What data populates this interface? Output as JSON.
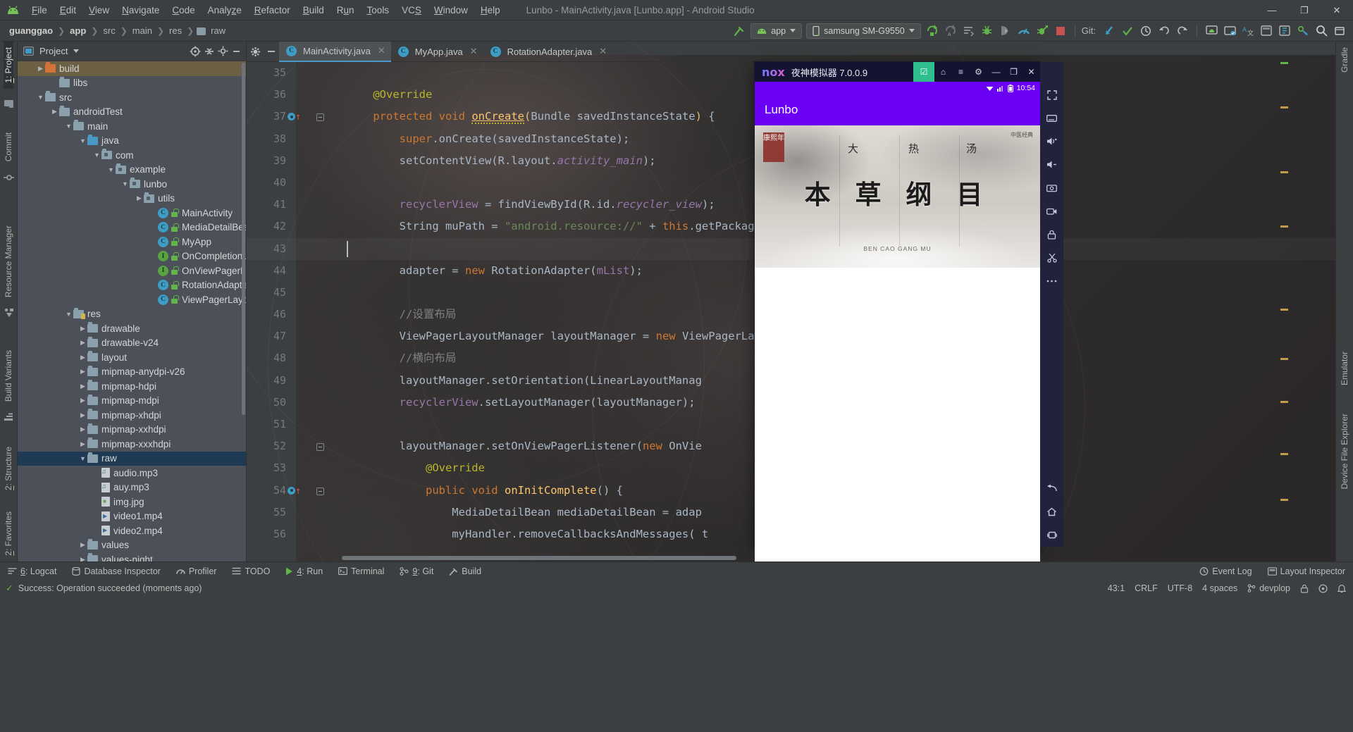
{
  "window": {
    "title": "Lunbo - MainActivity.java [Lunbo.app] - Android Studio",
    "minimize": "—",
    "maximize": "❐",
    "close": "✕"
  },
  "menubar": {
    "logo_icon": "android-logo-icon",
    "items": [
      {
        "label": "File",
        "mnemonic": "F"
      },
      {
        "label": "Edit",
        "mnemonic": "E"
      },
      {
        "label": "View",
        "mnemonic": "V"
      },
      {
        "label": "Navigate",
        "mnemonic": "N"
      },
      {
        "label": "Code",
        "mnemonic": "C"
      },
      {
        "label": "Analyze",
        "mnemonic": "z"
      },
      {
        "label": "Refactor",
        "mnemonic": "R"
      },
      {
        "label": "Build",
        "mnemonic": "B"
      },
      {
        "label": "Run",
        "mnemonic": "u"
      },
      {
        "label": "Tools",
        "mnemonic": "T"
      },
      {
        "label": "VCS",
        "mnemonic": "S"
      },
      {
        "label": "Window",
        "mnemonic": "W"
      },
      {
        "label": "Help",
        "mnemonic": "H"
      }
    ]
  },
  "breadcrumbs": [
    {
      "label": "guanggao",
      "bold": true
    },
    {
      "label": "app",
      "bold": true
    },
    {
      "label": "src",
      "bold": false
    },
    {
      "label": "main",
      "bold": false
    },
    {
      "label": "res",
      "bold": false
    },
    {
      "label": "raw",
      "bold": false,
      "folder": true
    }
  ],
  "toolbar": {
    "hammer_icon": "build-hammer-icon",
    "run_config": {
      "label": "app",
      "icon": "android-app-icon"
    },
    "device": {
      "label": "samsung SM-G9550",
      "icon": "phone-icon"
    },
    "run_icon": "run-icon",
    "rerun_icon": "apply-changes-icon",
    "apply_code_icon": "apply-code-changes-icon",
    "debug_icon": "debug-icon",
    "attach_debug_icon": "attach-debugger-icon",
    "profiler_icon": "profiler-icon",
    "run_with_coverage_icon": "run-coverage-icon",
    "stop_icon": "stop-icon",
    "git_label": "Git:",
    "git_update_icon": "git-update-icon",
    "git_commit_icon": "git-commit-check-icon",
    "git_history_icon": "git-history-icon",
    "undo_icon": "undo-icon",
    "redo_icon": "redo-icon",
    "avd_icon": "avd-manager-icon",
    "sdk_icon": "sdk-manager-icon",
    "translate_icon": "translate-icon",
    "layout_icon": "layout-editor-icon",
    "project_structure_icon": "project-structure-icon",
    "sync_icon": "gradle-sync-icon",
    "search_icon": "search-icon",
    "more_icon": "more-icon"
  },
  "left_strip": {
    "tabs": [
      {
        "label": "1: Project",
        "mnemonic": "1",
        "active": true,
        "icon": "project-icon"
      },
      {
        "label": "Commit",
        "icon": "commit-icon"
      },
      {
        "label": "Resource Manager",
        "icon": "resource-manager-icon"
      },
      {
        "label": "Build Variants",
        "icon": "build-variants-icon"
      },
      {
        "label": "2: Structure",
        "mnemonic": "2",
        "icon": "structure-icon"
      },
      {
        "label": "2: Favorites",
        "mnemonic": "2",
        "icon": "favorites-icon"
      }
    ]
  },
  "right_strip": {
    "tabs": [
      {
        "label": "Gradle",
        "icon": "gradle-icon"
      },
      {
        "label": "Emulator",
        "icon": "emulator-icon"
      },
      {
        "label": "Device File Explorer",
        "icon": "device-file-explorer-icon"
      }
    ],
    "icons": [
      "expand-icon",
      "layout-inspector-icon",
      "volume-up-icon",
      "volume-down-icon",
      "screenshot-icon",
      "screen-record-icon",
      "rotate-icon",
      "scissors-icon",
      "more-dots-icon",
      "back-icon",
      "home-icon",
      "recents-icon"
    ]
  },
  "project_panel": {
    "title": "Project",
    "view_icon": "project-view-icon",
    "caret_icon": "chevron-down-icon",
    "target_icon": "scroll-from-source-icon",
    "collapse_icon": "collapse-all-icon",
    "settings_icon": "gear-icon",
    "hide_icon": "hide-icon",
    "tree": [
      {
        "label": "build",
        "indent": 2,
        "arrow": "right",
        "icon": "folder-orange",
        "selected": "gold"
      },
      {
        "label": "libs",
        "indent": 3,
        "arrow": "none",
        "icon": "folder"
      },
      {
        "label": "src",
        "indent": 2,
        "arrow": "down",
        "icon": "folder"
      },
      {
        "label": "androidTest",
        "indent": 3,
        "arrow": "right",
        "icon": "folder"
      },
      {
        "label": "main",
        "indent": 4,
        "arrow": "down",
        "icon": "folder"
      },
      {
        "label": "java",
        "indent": 5,
        "arrow": "down",
        "icon": "folder-blue"
      },
      {
        "label": "com",
        "indent": 6,
        "arrow": "down",
        "icon": "folder-package"
      },
      {
        "label": "example",
        "indent": 7,
        "arrow": "down",
        "icon": "folder-package"
      },
      {
        "label": "lunbo",
        "indent": 8,
        "arrow": "down",
        "icon": "folder-package"
      },
      {
        "label": "utils",
        "indent": 9,
        "arrow": "right",
        "icon": "folder-package"
      },
      {
        "label": "MainActivity",
        "indent": 10,
        "arrow": "none",
        "icon": "class-badge"
      },
      {
        "label": "MediaDetailBean",
        "indent": 10,
        "arrow": "none",
        "icon": "class-badge"
      },
      {
        "label": "MyApp",
        "indent": 10,
        "arrow": "none",
        "icon": "class-badge"
      },
      {
        "label": "OnCompletionListener",
        "indent": 10,
        "arrow": "none",
        "icon": "interface-badge"
      },
      {
        "label": "OnViewPagerListener",
        "indent": 10,
        "arrow": "none",
        "icon": "interface-badge"
      },
      {
        "label": "RotationAdapter",
        "indent": 10,
        "arrow": "none",
        "icon": "class-badge"
      },
      {
        "label": "ViewPagerLayoutManager",
        "indent": 10,
        "arrow": "none",
        "icon": "class-badge"
      },
      {
        "label": "res",
        "indent": 4,
        "arrow": "down",
        "icon": "folder-res"
      },
      {
        "label": "drawable",
        "indent": 5,
        "arrow": "right",
        "icon": "folder"
      },
      {
        "label": "drawable-v24",
        "indent": 5,
        "arrow": "right",
        "icon": "folder"
      },
      {
        "label": "layout",
        "indent": 5,
        "arrow": "right",
        "icon": "folder"
      },
      {
        "label": "mipmap-anydpi-v26",
        "indent": 5,
        "arrow": "right",
        "icon": "folder"
      },
      {
        "label": "mipmap-hdpi",
        "indent": 5,
        "arrow": "right",
        "icon": "folder"
      },
      {
        "label": "mipmap-mdpi",
        "indent": 5,
        "arrow": "right",
        "icon": "folder"
      },
      {
        "label": "mipmap-xhdpi",
        "indent": 5,
        "arrow": "right",
        "icon": "folder"
      },
      {
        "label": "mipmap-xxhdpi",
        "indent": 5,
        "arrow": "right",
        "icon": "folder"
      },
      {
        "label": "mipmap-xxxhdpi",
        "indent": 5,
        "arrow": "right",
        "icon": "folder"
      },
      {
        "label": "raw",
        "indent": 5,
        "arrow": "down",
        "icon": "folder",
        "selected": "blue"
      },
      {
        "label": "audio.mp3",
        "indent": 6,
        "arrow": "none",
        "icon": "file-audio"
      },
      {
        "label": "auy.mp3",
        "indent": 6,
        "arrow": "none",
        "icon": "file-audio"
      },
      {
        "label": "img.jpg",
        "indent": 6,
        "arrow": "none",
        "icon": "file-image"
      },
      {
        "label": "video1.mp4",
        "indent": 6,
        "arrow": "none",
        "icon": "file-video"
      },
      {
        "label": "video2.mp4",
        "indent": 6,
        "arrow": "none",
        "icon": "file-video"
      },
      {
        "label": "values",
        "indent": 5,
        "arrow": "right",
        "icon": "folder"
      },
      {
        "label": "values-night",
        "indent": 5,
        "arrow": "right",
        "icon": "folder"
      }
    ]
  },
  "editor": {
    "gear_icon": "gear-icon",
    "minimize_icon": "minimize-icon",
    "tabs": [
      {
        "label": "MainActivity.java",
        "active": true,
        "icon": "class-badge",
        "close": "✕"
      },
      {
        "label": "MyApp.java",
        "active": false,
        "icon": "class-badge",
        "close": "✕"
      },
      {
        "label": "RotationAdapter.java",
        "active": false,
        "icon": "class-badge",
        "close": "✕"
      }
    ],
    "lines": [
      {
        "n": "35",
        "tokens": []
      },
      {
        "n": "36",
        "tokens": [
          {
            "t": "    ",
            "c": "txt"
          },
          {
            "t": "@Override",
            "c": "ann"
          }
        ]
      },
      {
        "n": "37",
        "gutter": "run-dot-up-arrow",
        "fold": true,
        "tokens": [
          {
            "t": "    ",
            "c": "txt"
          },
          {
            "t": "protected ",
            "c": "kw"
          },
          {
            "t": "void ",
            "c": "kw"
          },
          {
            "t": "onCreate",
            "c": "fn-u"
          },
          {
            "t": "(",
            "c": "paren"
          },
          {
            "t": "Bundle savedInstanceState",
            "c": "txt"
          },
          {
            "t": ")",
            "c": "paren"
          },
          {
            "t": " {",
            "c": "txt"
          }
        ]
      },
      {
        "n": "38",
        "tokens": [
          {
            "t": "        ",
            "c": "txt"
          },
          {
            "t": "super",
            "c": "kw"
          },
          {
            "t": ".onCreate(savedInstanceState);",
            "c": "txt"
          }
        ]
      },
      {
        "n": "39",
        "tokens": [
          {
            "t": "        setContentView(R.layout.",
            "c": "txt"
          },
          {
            "t": "activity_main",
            "c": "fld-i"
          },
          {
            "t": ");",
            "c": "txt"
          }
        ]
      },
      {
        "n": "40",
        "tokens": []
      },
      {
        "n": "41",
        "tokens": [
          {
            "t": "        ",
            "c": "txt"
          },
          {
            "t": "recyclerView",
            "c": "fld"
          },
          {
            "t": " = findViewById(R.id.",
            "c": "txt"
          },
          {
            "t": "recycler_view",
            "c": "fld-i"
          },
          {
            "t": ");",
            "c": "txt"
          }
        ]
      },
      {
        "n": "42",
        "tokens": [
          {
            "t": "        String muPath = ",
            "c": "txt"
          },
          {
            "t": "\"android.resource://\"",
            "c": "str"
          },
          {
            "t": " + ",
            "c": "txt"
          },
          {
            "t": "this",
            "c": "kw"
          },
          {
            "t": ".getPackageName();",
            "c": "txt"
          }
        ]
      },
      {
        "n": "43",
        "current": true,
        "tokens": []
      },
      {
        "n": "44",
        "tokens": [
          {
            "t": "        adapter = ",
            "c": "txt"
          },
          {
            "t": "new ",
            "c": "kw"
          },
          {
            "t": "RotationAdapter(",
            "c": "txt"
          },
          {
            "t": "mList",
            "c": "fld"
          },
          {
            "t": ");",
            "c": "txt"
          }
        ]
      },
      {
        "n": "45",
        "tokens": []
      },
      {
        "n": "46",
        "tokens": [
          {
            "t": "        //设置布局",
            "c": "cmt"
          }
        ]
      },
      {
        "n": "47",
        "tokens": [
          {
            "t": "        ViewPagerLayoutManager layoutManager = ",
            "c": "txt"
          },
          {
            "t": "new ",
            "c": "kw"
          },
          {
            "t": "ViewPagerLayoutManager(",
            "c": "txt"
          }
        ]
      },
      {
        "n": "48",
        "tokens": [
          {
            "t": "        //横向布局",
            "c": "cmt"
          }
        ]
      },
      {
        "n": "49",
        "tokens": [
          {
            "t": "        layoutManager.setOrientation(LinearLayoutManag",
            "c": "txt"
          }
        ]
      },
      {
        "n": "50",
        "tokens": [
          {
            "t": "        ",
            "c": "txt"
          },
          {
            "t": "recyclerView",
            "c": "fld"
          },
          {
            "t": ".setLayoutManager(layoutManager);",
            "c": "txt"
          }
        ]
      },
      {
        "n": "51",
        "tokens": []
      },
      {
        "n": "52",
        "fold": true,
        "tokens": [
          {
            "t": "        layoutManager.setOnViewPagerListener(",
            "c": "txt"
          },
          {
            "t": "new ",
            "c": "kw"
          },
          {
            "t": "OnVie",
            "c": "txt"
          }
        ]
      },
      {
        "n": "53",
        "tokens": [
          {
            "t": "            ",
            "c": "txt"
          },
          {
            "t": "@Override",
            "c": "ann"
          }
        ]
      },
      {
        "n": "54",
        "gutter": "run-dot-up-arrow",
        "fold": true,
        "tokens": [
          {
            "t": "            ",
            "c": "txt"
          },
          {
            "t": "public ",
            "c": "kw"
          },
          {
            "t": "void ",
            "c": "kw"
          },
          {
            "t": "onInitComplete",
            "c": "fn"
          },
          {
            "t": "() {",
            "c": "txt"
          }
        ]
      },
      {
        "n": "55",
        "tokens": [
          {
            "t": "                MediaDetailBean mediaDetailBean = adap",
            "c": "txt"
          }
        ]
      },
      {
        "n": "56",
        "tokens": [
          {
            "t": "                myHandler.removeCallbacksAndMessages( t",
            "c": "txt"
          }
        ]
      }
    ]
  },
  "nox": {
    "logo": "nox",
    "name": "夜神模拟器 7.0.0.9",
    "controls": [
      {
        "icon": "nox-store-icon",
        "green": true,
        "label": "☑"
      },
      {
        "icon": "nox-apk-icon",
        "label": "⌂"
      },
      {
        "icon": "nox-menu-icon",
        "label": "≡"
      },
      {
        "icon": "nox-settings-icon",
        "label": "⚙"
      },
      {
        "icon": "minimize-icon",
        "label": "—"
      },
      {
        "icon": "maximize-icon",
        "label": "❐"
      },
      {
        "icon": "close-icon",
        "label": "✕"
      },
      {
        "icon": "collapse-sidebar-icon",
        "label": "≪"
      }
    ],
    "status": {
      "wifi_icon": "wifi-icon",
      "signal_icon": "signal-icon",
      "battery_icon": "battery-icon",
      "time": "10:54"
    },
    "appbar_title": "Lunbo",
    "banner": {
      "title": "本 草 纲 目",
      "seal": "康熙年",
      "corner_note": "中医经典",
      "side_chars": [
        "大",
        "热",
        "汤"
      ],
      "subtitle": "BEN CAO GANG MU"
    },
    "sidebar_icons": [
      "fullscreen-icon",
      "keyboard-icon",
      "volume-up-icon",
      "volume-down-icon",
      "screenshot-icon",
      "video-record-icon",
      "lock-icon",
      "scissors-icon",
      "more-dots-icon",
      "back-icon",
      "home-icon",
      "recents-icon"
    ]
  },
  "bottombar": {
    "items": [
      {
        "label": "6: Logcat",
        "mnemonic": "6",
        "icon": "logcat-icon"
      },
      {
        "label": "Database Inspector",
        "icon": "database-icon"
      },
      {
        "label": "Profiler",
        "icon": "profiler-icon"
      },
      {
        "label": "TODO",
        "icon": "todo-icon"
      },
      {
        "label": "4: Run",
        "mnemonic": "4",
        "icon": "run-icon"
      },
      {
        "label": "Terminal",
        "icon": "terminal-icon"
      },
      {
        "label": "9: Git",
        "mnemonic": "9",
        "icon": "git-icon"
      },
      {
        "label": "Build",
        "icon": "build-icon"
      }
    ],
    "right_items": [
      {
        "label": "Event Log",
        "icon": "event-log-icon"
      },
      {
        "label": "Layout Inspector",
        "icon": "layout-inspector-icon"
      }
    ]
  },
  "statusbar": {
    "message": "Success: Operation succeeded (moments ago)",
    "message_icon": "success-check-icon",
    "position": "43:1",
    "line_separator": "CRLF",
    "encoding": "UTF-8",
    "indent": "4 spaces",
    "branch": "devplop",
    "branch_icon": "git-branch-icon",
    "lock_icon": "read-only-lock-icon",
    "inspections_icon": "inspections-icon",
    "notifications_icon": "notifications-icon"
  },
  "colors": {
    "accent_blue": "#4b9bd1",
    "nox_purple": "#6a00f4",
    "green": "#62b54a",
    "orange_kw": "#cc7832",
    "gold_fn": "#ffc66d",
    "string_green": "#6a8759",
    "field_purple": "#9876aa",
    "selection_blue": "#1f3a54",
    "selection_gold": "#6b6044",
    "stop_red": "#c75450"
  }
}
